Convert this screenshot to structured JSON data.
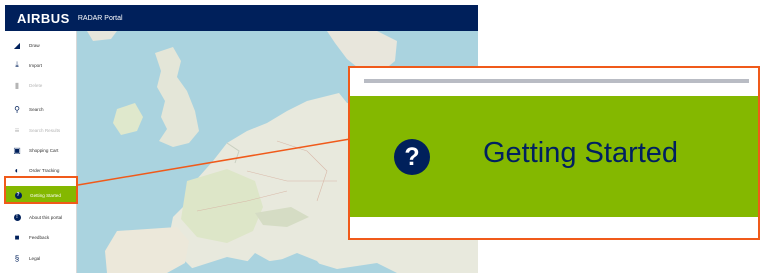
{
  "header": {
    "brand": "AIRBUS",
    "product": "RADAR Portal"
  },
  "sidebar": {
    "items": [
      {
        "label": "Draw",
        "icon": "draw-icon",
        "disabled": false
      },
      {
        "label": "Import",
        "icon": "upload-icon",
        "disabled": false
      },
      {
        "label": "Delete",
        "icon": "trash-icon",
        "disabled": true
      },
      {
        "label": "Search",
        "icon": "search-icon",
        "disabled": false
      },
      {
        "label": "Search Results",
        "icon": "search-results-icon",
        "disabled": true
      },
      {
        "label": "Shopping Cart",
        "icon": "cart-icon",
        "disabled": false
      },
      {
        "label": "Order Tracking",
        "icon": "tracking-icon",
        "disabled": false
      },
      {
        "label": "Getting Started",
        "icon": "help-icon",
        "active": true
      },
      {
        "label": "About this portal",
        "icon": "info-icon",
        "disabled": false
      },
      {
        "label": "Feedback",
        "icon": "feedback-icon",
        "disabled": false
      },
      {
        "label": "Legal",
        "icon": "legal-icon",
        "disabled": false
      }
    ]
  },
  "callout": {
    "label": "Getting Started",
    "icon": "help-icon"
  },
  "colors": {
    "header": "#00205b",
    "active": "#84b800",
    "highlight": "#f05a1a",
    "navy": "#00205b"
  }
}
